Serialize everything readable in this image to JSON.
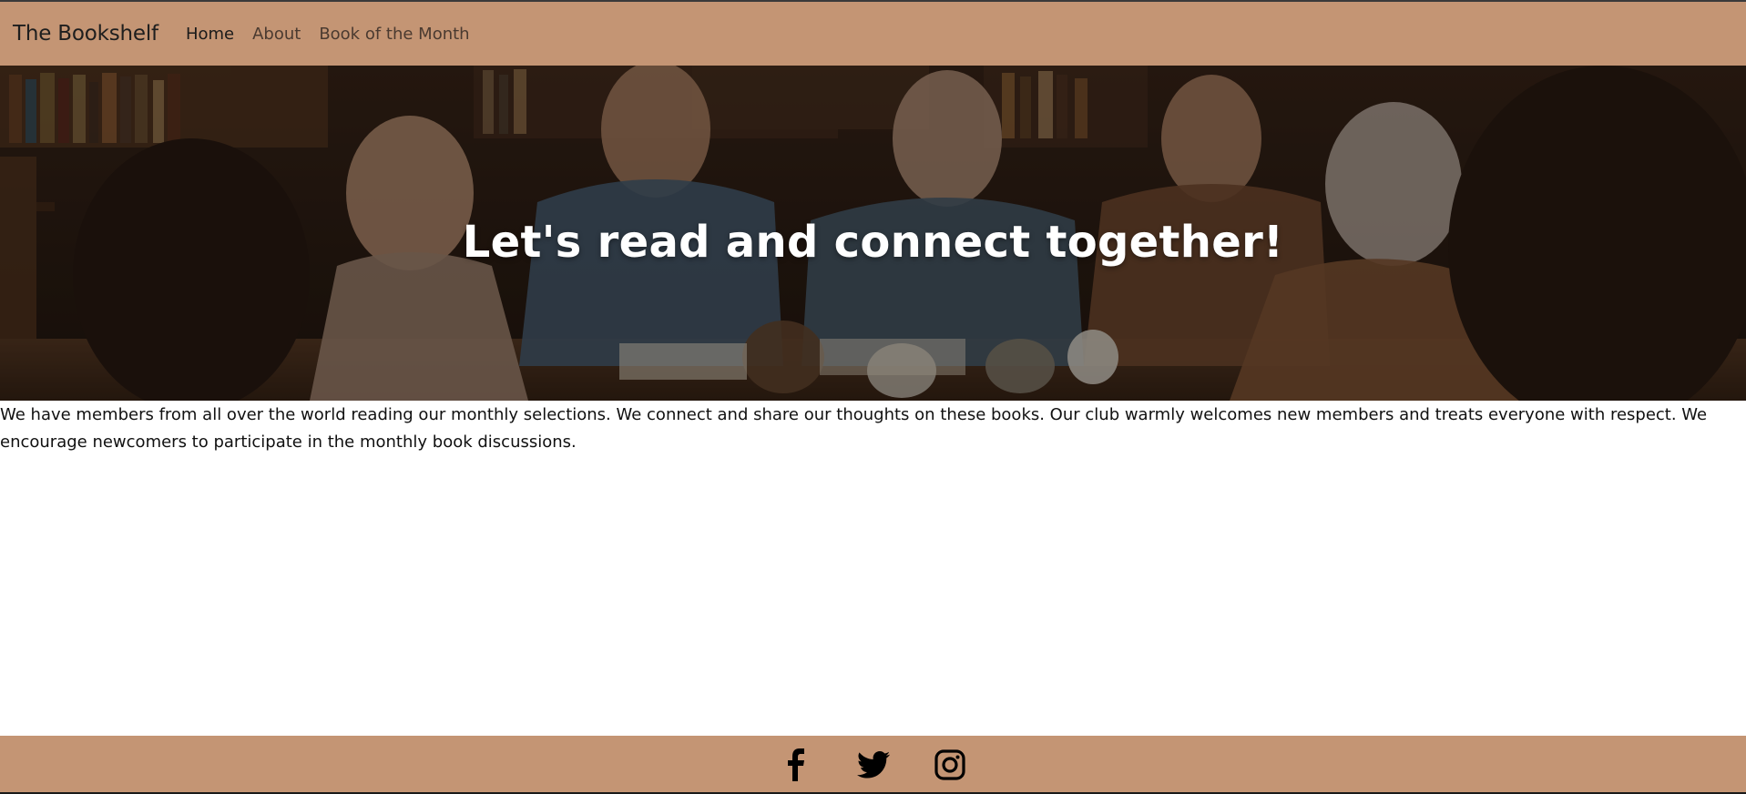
{
  "nav": {
    "brand": "The Bookshelf",
    "links": [
      {
        "label": "Home",
        "active": true
      },
      {
        "label": "About",
        "active": false
      },
      {
        "label": "Book of the Month",
        "active": false
      }
    ]
  },
  "hero": {
    "title": "Let's read and connect together!",
    "image": "book-club-group-at-table-photo"
  },
  "intro": {
    "text": "We have members from all over the world reading our monthly selections. We connect and share our thoughts on these books. Our club warmly welcomes new members and treats everyone with respect. We encourage newcomers to participate in the monthly book discussions."
  },
  "footer": {
    "social": [
      "facebook-icon",
      "twitter-icon",
      "instagram-icon"
    ]
  },
  "colors": {
    "navbar": "#c49574",
    "footer": "#c49574",
    "hero_text": "#ffffff"
  }
}
